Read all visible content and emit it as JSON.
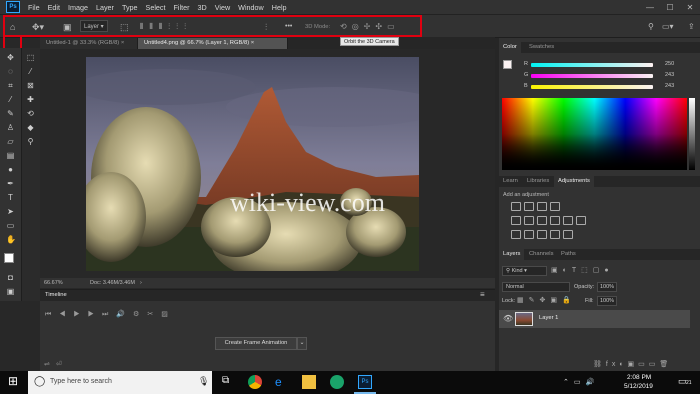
{
  "menu": {
    "app_badge": "Ps",
    "items": [
      "File",
      "Edit",
      "Image",
      "Layer",
      "Type",
      "Select",
      "Filter",
      "3D",
      "View",
      "Window",
      "Help"
    ],
    "win_min": "—",
    "win_max": "☐",
    "win_close": "✕"
  },
  "options": {
    "layer_select": "Layer",
    "more": "•••",
    "mode_3d": "3D Mode:",
    "tooltip": "Orbit the 3D Camera"
  },
  "tabs": [
    {
      "label": "Untitled-1 @ 33.3% (RGB/8)",
      "close": "×"
    },
    {
      "label": "Untitled4.png @ 66.7% (Layer 1, RGB/8)",
      "close": "×"
    }
  ],
  "status": {
    "zoom": "66.67%",
    "doc": "Doc: 3.46M/3.46M"
  },
  "timeline": {
    "title": "Timeline",
    "create_button": "Create Frame Animation"
  },
  "watermark": "wiki-view.com",
  "color_panel": {
    "tabs": [
      "Color",
      "Swatches"
    ],
    "channels": [
      {
        "label": "R",
        "value": "250",
        "color": "#00e5ff"
      },
      {
        "label": "G",
        "value": "243",
        "color": "#ff27ff"
      },
      {
        "label": "B",
        "value": "243",
        "color": "#fff200"
      }
    ]
  },
  "adjustments_panel": {
    "tabs": [
      "Learn",
      "Libraries",
      "Adjustments"
    ],
    "add_label": "Add an adjustment"
  },
  "layers_panel": {
    "tabs": [
      "Layers",
      "Channels",
      "Paths"
    ],
    "filter_kind": "Kind",
    "blend_mode": "Normal",
    "opacity_label": "Opacity:",
    "opacity_value": "100%",
    "lock_label": "Lock:",
    "fill_label": "Fill:",
    "fill_value": "100%",
    "layer_name": "Layer 1"
  },
  "taskbar": {
    "search_placeholder": "Type here to search",
    "time": "2:08 PM",
    "date": "5/12/2019",
    "notif_count": "21",
    "ps_label": "Ps"
  },
  "colors": {
    "accent": "#31a8ff",
    "highlight": "#e00010"
  }
}
